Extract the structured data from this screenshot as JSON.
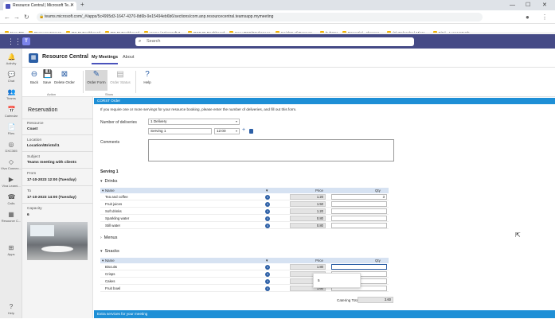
{
  "browser": {
    "tab_title": "Resource Central | Microsoft Te...",
    "url": "teams.microsoft.com/_#/apps/5c4995d3-1647-4370-8d6b-9e15494eb6b6/sections/com.anp.resourcecentral.teamsapp.mymeeting",
    "bookmarks": [
      "New RC",
      "ResourceXpress",
      "RX BI Dashboard",
      "RC BI Dashboard",
      "Home | Microsoft 3...",
      "DXC BI Dashboard",
      "New-DSS/Workspace",
      "Insights of Resourc...",
      "hubstar",
      "Essential - sharepo...",
      "(1) Calendar | Micro...",
      "Sitel - Lucas Marsh..."
    ]
  },
  "teams": {
    "search_placeholder": "Search",
    "rail": [
      "Activity",
      "Chat",
      "Teams",
      "Calendar",
      "Files",
      "DXC365",
      "Viva Connec...",
      "Viva Learni...",
      "Calls",
      "Resource C...",
      "Apps",
      "Help"
    ]
  },
  "app": {
    "title": "Resource Central",
    "tabs": [
      "My Meetings",
      "About"
    ]
  },
  "ribbon": {
    "back": "Back",
    "save": "Save",
    "delete": "Delete Order",
    "order_form": "Order Form",
    "order_status": "Order Status",
    "help": "Help",
    "group_action": "Action",
    "group_show": "Show"
  },
  "reservation": {
    "heading": "Reservation",
    "resource_label": "Resource",
    "resource_value": "Coast",
    "location_label": "Location",
    "location_value": "Location\\Bristol\\1",
    "subject_label": "Subject",
    "subject_value": "Teams meeting with clients",
    "from_label": "From",
    "from_value": "17-10-2023 12:00 (Tuesday)",
    "to_label": "To",
    "to_value": "17-10-2023 14:00 (Tuesday)",
    "capacity_label": "Capacity",
    "capacity_value": "6"
  },
  "order": {
    "header": "CORST Order",
    "intro": "If you require one or more servings for your resource booking, please enter the number of deliveries, and fill out this form.",
    "deliveries_label": "Number of deliveries",
    "deliveries_value": "1 Delivery",
    "serving_name": "Serving 1",
    "serving_time": "12:00",
    "comments_label": "Comments",
    "serving_heading": "Serving 1",
    "col_name": "Name",
    "col_price": "Price",
    "col_qty": "Qty",
    "drinks_label": "Drinks",
    "drinks": [
      {
        "name": "Tea and coffee",
        "price": "1.20",
        "qty": "3"
      },
      {
        "name": "Fruit juices",
        "price": "1.50",
        "qty": ""
      },
      {
        "name": "Soft drinks",
        "price": "1.20",
        "qty": ""
      },
      {
        "name": "Sparkling water",
        "price": "0.80",
        "qty": ""
      },
      {
        "name": "Still water",
        "price": "0.80",
        "qty": ""
      }
    ],
    "menus_label": "Menus",
    "snacks_label": "Snacks",
    "snacks": [
      {
        "name": "Biscuits",
        "price": "1.80",
        "qty": ""
      },
      {
        "name": "Crisps",
        "price": "0.",
        "qty": ""
      },
      {
        "name": "Cakes",
        "price": "2.",
        "qty": ""
      },
      {
        "name": "Fruit bowl",
        "price": "1.60",
        "qty": ""
      }
    ],
    "popup_value": "5",
    "total_label": "Catering Total",
    "total_value": "3.60",
    "bottom_bar": "Extra services for your meeting"
  }
}
